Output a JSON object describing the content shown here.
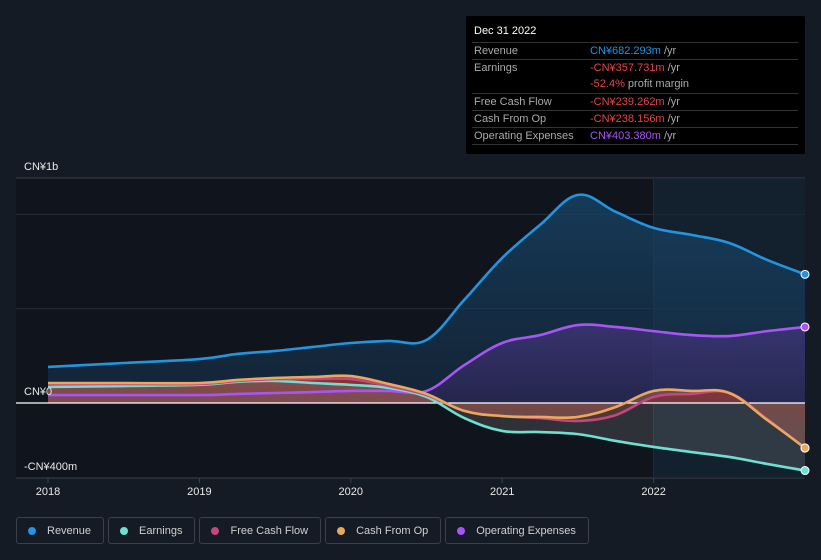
{
  "tooltip": {
    "date": "Dec 31 2022",
    "rows": [
      {
        "label": "Revenue",
        "value": "CN¥682.293m",
        "unit": " /yr",
        "color": "#2394df"
      },
      {
        "label": "Earnings",
        "value": "-CN¥357.731m",
        "unit": " /yr",
        "color": "#e64545"
      },
      {
        "label": "",
        "value": "-52.4%",
        "unit": " profit margin",
        "color": "#e64545"
      },
      {
        "label": "Free Cash Flow",
        "value": "-CN¥239.262m",
        "unit": " /yr",
        "color": "#e64545"
      },
      {
        "label": "Cash From Op",
        "value": "-CN¥238.156m",
        "unit": " /yr",
        "color": "#e64545"
      },
      {
        "label": "Operating Expenses",
        "value": "CN¥403.380m",
        "unit": " /yr",
        "color": "#a855f7"
      }
    ]
  },
  "legend": [
    {
      "label": "Revenue",
      "color": "#2394df"
    },
    {
      "label": "Earnings",
      "color": "#6ee0d2"
    },
    {
      "label": "Free Cash Flow",
      "color": "#c2477e"
    },
    {
      "label": "Cash From Op",
      "color": "#e9a85c"
    },
    {
      "label": "Operating Expenses",
      "color": "#a855f7"
    }
  ],
  "chart_data": {
    "type": "area",
    "title": "",
    "xlabel": "",
    "ylabel": "",
    "currency": "CN¥",
    "y_tick_labels": [
      "CN¥1b",
      "CN¥0",
      "-CN¥400m"
    ],
    "y_ticks": [
      1000,
      0,
      -400
    ],
    "ylim": [
      -400,
      1190
    ],
    "xlim": [
      2018.0,
      2023.0
    ],
    "x_tick_labels": [
      "2018",
      "2019",
      "2020",
      "2021",
      "2022"
    ],
    "x_ticks": [
      2018,
      2019,
      2020,
      2021,
      2022
    ],
    "highlight_range": [
      2022.0,
      2023.0
    ],
    "grid": true,
    "legend_position": "bottom-left",
    "x": [
      2018.0,
      2018.5,
      2019.0,
      2019.25,
      2019.5,
      2019.75,
      2020.0,
      2020.25,
      2020.5,
      2020.75,
      2021.0,
      2021.25,
      2021.5,
      2021.75,
      2022.0,
      2022.25,
      2022.5,
      2022.75,
      2023.0
    ],
    "series": [
      {
        "name": "Revenue",
        "unit": "CN¥m",
        "values": [
          191,
          212,
          233,
          260,
          276,
          297,
          318,
          329,
          334,
          547,
          769,
          944,
          1103,
          1013,
          928,
          891,
          848,
          758,
          682
        ]
      },
      {
        "name": "Earnings",
        "unit": "CN¥m",
        "values": [
          85,
          90,
          96,
          112,
          117,
          106,
          96,
          80,
          32,
          -80,
          -148,
          -154,
          -165,
          -201,
          -233,
          -260,
          -286,
          -323,
          -358
        ]
      },
      {
        "name": "Free Cash Flow",
        "unit": "CN¥m",
        "values": [
          101,
          101,
          101,
          117,
          127,
          127,
          127,
          90,
          42,
          -42,
          -69,
          -80,
          -95,
          -64,
          32,
          48,
          53,
          -85,
          -239
        ]
      },
      {
        "name": "Cash From Op",
        "unit": "CN¥m",
        "values": [
          106,
          106,
          106,
          122,
          133,
          138,
          143,
          101,
          48,
          -42,
          -69,
          -74,
          -74,
          -21,
          64,
          64,
          53,
          -90,
          -238
        ]
      },
      {
        "name": "Operating Expenses",
        "unit": "CN¥m",
        "values": [
          42,
          42,
          42,
          48,
          53,
          58,
          64,
          64,
          64,
          201,
          318,
          360,
          413,
          403,
          381,
          360,
          355,
          381,
          403
        ]
      }
    ]
  }
}
